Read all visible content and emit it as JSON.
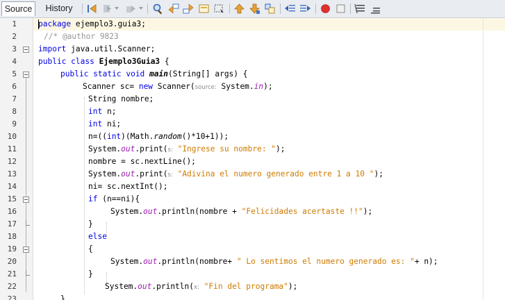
{
  "tabs": [
    {
      "label": "Source",
      "active": true
    },
    {
      "label": "History",
      "active": false
    }
  ],
  "toolbar_icons": [
    "back-icon",
    "forward-icon",
    "history-icon",
    "find-icon",
    "find-previous-icon",
    "find-next-icon",
    "find-selection-icon",
    "toggle-highlight-icon",
    "previous-bookmark-icon",
    "next-bookmark-icon",
    "toggle-bookmark-icon",
    "shift-left-icon",
    "shift-right-icon",
    "start-macro-icon",
    "stop-macro-icon",
    "comment-icon",
    "uncomment-icon"
  ],
  "colors": {
    "keyword": "#0000e6",
    "string": "#ce7b00",
    "comment": "#969696",
    "field": "#9b1caf",
    "current_line": "#fcf7e3",
    "macro_record": "#e03030"
  },
  "code": {
    "line_numbers": [
      "1",
      "2",
      "3",
      "4",
      "5",
      "6",
      "7",
      "8",
      "9",
      "10",
      "11",
      "12",
      "13",
      "14",
      "15",
      "16",
      "17",
      "18",
      "19",
      "20",
      "21",
      "22",
      "23"
    ],
    "l1": {
      "kw": "package",
      "rest": " ejemplo3.guia3;"
    },
    "l2": {
      "comment": "//* @author 9823"
    },
    "l3": {
      "kw": "import",
      "rest": " java.util.Scanner;"
    },
    "l4": {
      "kw1": "public",
      "kw2": "class",
      "name": "Ejemplo3Guia3",
      "rest": " {"
    },
    "l5": {
      "kw1": "public",
      "kw2": "static",
      "kw3": "void",
      "method": "main",
      "rest": "(String[] args) {"
    },
    "l6": {
      "a": "Scanner sc= ",
      "kw": "new",
      "b": " Scanner(",
      "hint": "source:",
      "c": " System.",
      "field": "in",
      "d": ");"
    },
    "l7": {
      "text": "String nombre;"
    },
    "l8": {
      "kw": "int",
      "rest": " n;"
    },
    "l9": {
      "kw": "int",
      "rest": " ni;"
    },
    "l10": {
      "a": "n=((",
      "kw": "int",
      "b": ")(Math.",
      "st": "random",
      "c": "()*10+1));"
    },
    "l11": {
      "a": "System.",
      "field": "out",
      "b": ".print(",
      "hint": "s:",
      "str": "\"Ingrese su nombre: \"",
      "c": ");"
    },
    "l12": {
      "text": "nombre = sc.nextLine();"
    },
    "l13": {
      "a": "System.",
      "field": "out",
      "b": ".print(",
      "hint": "s:",
      "str": "\"Adivina el numero generado entre 1 a 10 \"",
      "c": ");"
    },
    "l14": {
      "text": "ni= sc.nextInt();"
    },
    "l15": {
      "kw": "if",
      "rest": " (n==ni){"
    },
    "l16": {
      "a": "System.",
      "field": "out",
      "b": ".println(nombre + ",
      "str": "\"Felicidades acertaste !!\"",
      "c": ");"
    },
    "l17": {
      "text": "}"
    },
    "l18": {
      "kw": "else"
    },
    "l19": {
      "text": "{"
    },
    "l20": {
      "a": "System.",
      "field": "out",
      "b": ".println(nombre+ ",
      "str": "\" Lo sentimos el numero generado es: \"",
      "c": "+ n);"
    },
    "l21": {
      "text": "}"
    },
    "l22": {
      "a": "System.",
      "field": "out",
      "b": ".println(",
      "hint": "x:",
      "str": "\"Fin del programa\"",
      "c": ");"
    },
    "l23": {
      "text": "}"
    }
  }
}
